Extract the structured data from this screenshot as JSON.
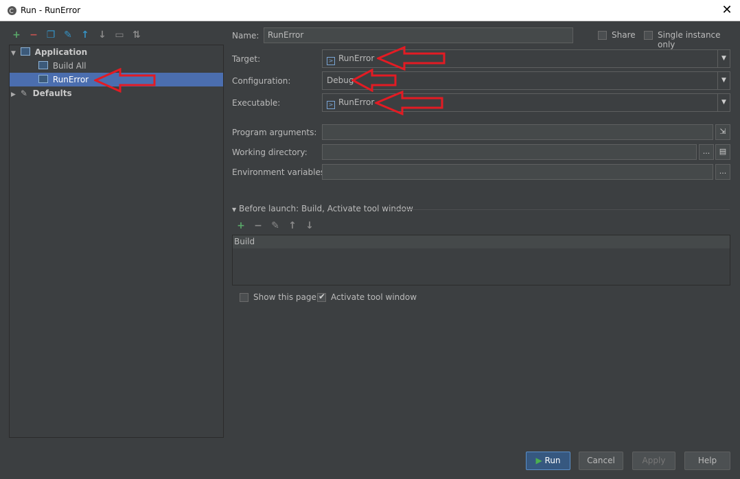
{
  "window": {
    "title": "Run - RunError"
  },
  "tree": {
    "application": "Application",
    "build_all": "Build All",
    "run_error": "RunError",
    "defaults": "Defaults"
  },
  "form": {
    "name_label": "Name:",
    "name_value": "RunError",
    "share_label": "Share",
    "single_instance_label": "Single instance only",
    "target_label": "Target:",
    "target_value": "RunError",
    "configuration_label": "Configuration:",
    "configuration_value": "Debug",
    "executable_label": "Executable:",
    "executable_value": "RunError",
    "program_args_label": "Program arguments:",
    "working_dir_label": "Working directory:",
    "env_vars_label": "Environment variables:",
    "ellipsis": "..."
  },
  "before_launch": {
    "title": "Before launch: Build, Activate tool window",
    "items": [
      "Build"
    ],
    "show_page_label": "Show this page",
    "activate_label": "Activate tool window"
  },
  "buttons": {
    "run": "Run",
    "cancel": "Cancel",
    "apply": "Apply",
    "help": "Help"
  },
  "colors": {
    "annotation_arrow": "#e31b23",
    "selection": "#4b6eaf"
  }
}
